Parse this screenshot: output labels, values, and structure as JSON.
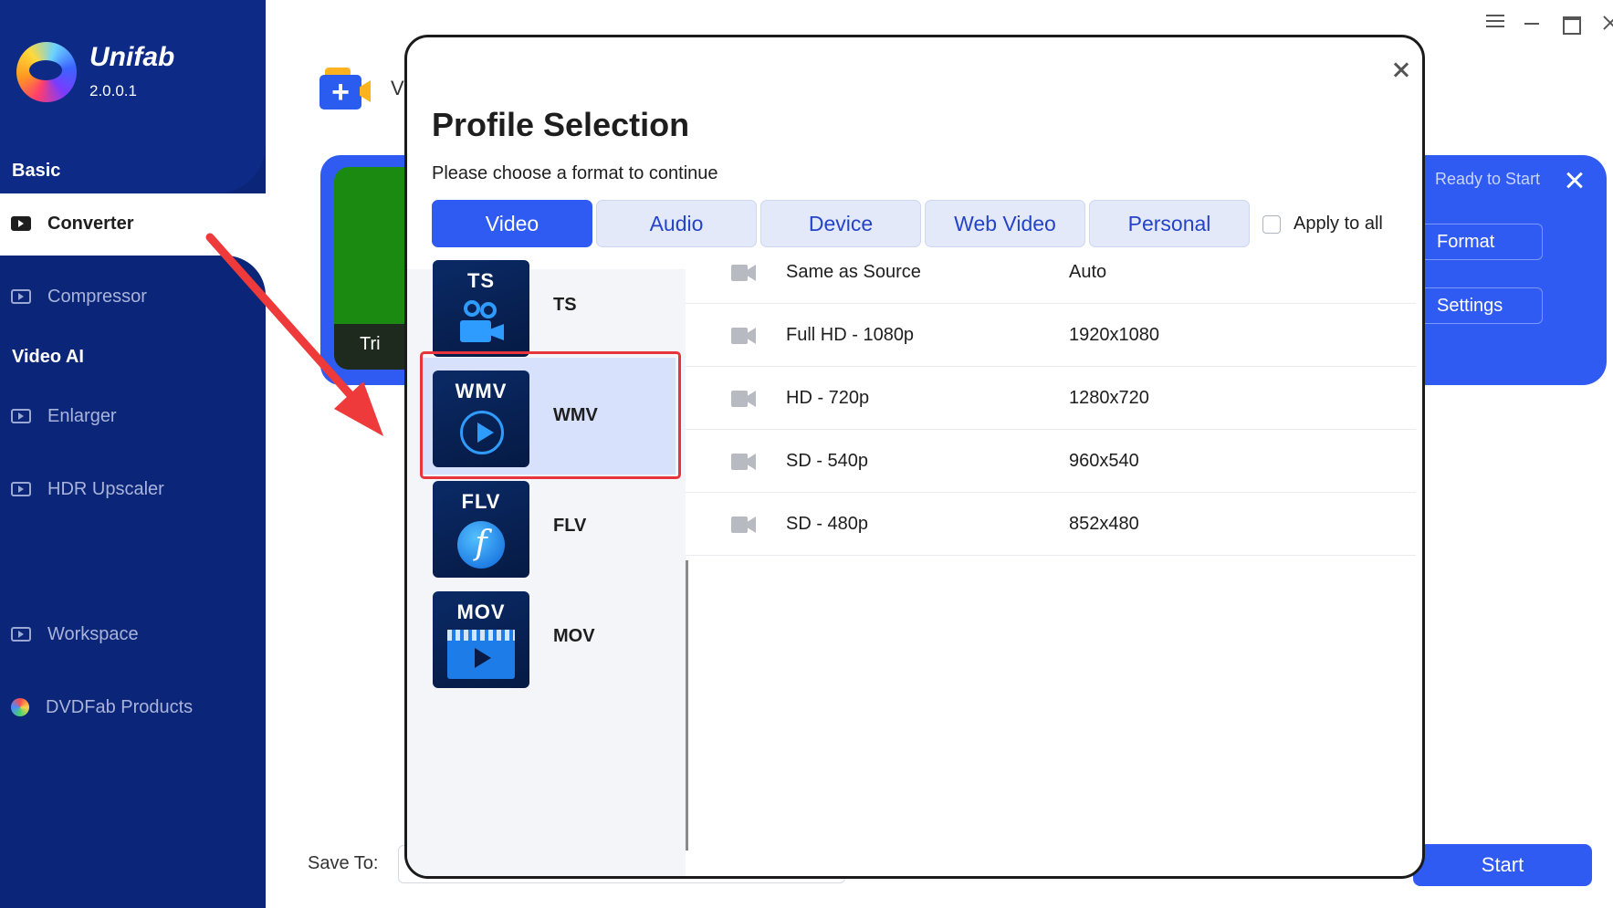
{
  "app": {
    "name": "Unifab",
    "version": "2.0.0.1"
  },
  "sidebar": {
    "section_basic": "Basic",
    "section_video_ai": "Video AI",
    "items": [
      {
        "label": "Converter",
        "icon": "converter-icon",
        "active": true
      },
      {
        "label": "Compressor",
        "icon": "compressor-icon"
      },
      {
        "label": "Enlarger",
        "icon": "enlarger-icon"
      },
      {
        "label": "HDR Upscaler",
        "icon": "hdr-icon"
      },
      {
        "label": "Workspace",
        "icon": "monitor-icon"
      },
      {
        "label": "DVDFab Products",
        "icon": "dvdfab-logo-icon"
      }
    ]
  },
  "main": {
    "add_label": "V",
    "video_trim_label": "Tri",
    "ready_label": "Ready to Start",
    "format_button": "Format",
    "settings_button": "Settings",
    "save_to_label": "Save To:",
    "start_button": "Start"
  },
  "modal": {
    "title": "Profile Selection",
    "subtitle": "Please choose a format to continue",
    "tabs": [
      "Video",
      "Audio",
      "Device",
      "Web Video",
      "Personal"
    ],
    "active_tab": "Video",
    "apply_all_label": "Apply to all",
    "apply_all_checked": false,
    "formats": [
      {
        "label": "TS",
        "icon_text": "TS"
      },
      {
        "label": "WMV",
        "icon_text": "WMV",
        "selected": true
      },
      {
        "label": "FLV",
        "icon_text": "FLV"
      },
      {
        "label": "MOV",
        "icon_text": "MOV"
      }
    ],
    "resolutions": [
      {
        "name": "Same as Source",
        "value": "Auto"
      },
      {
        "name": "Full HD - 1080p",
        "value": "1920x1080"
      },
      {
        "name": "HD - 720p",
        "value": "1280x720"
      },
      {
        "name": "SD - 540p",
        "value": "960x540"
      },
      {
        "name": "SD - 480p",
        "value": "852x480"
      }
    ]
  },
  "colors": {
    "sidebar": "#0b2578",
    "accent": "#2f5bf3",
    "highlight": "#e8343b"
  }
}
